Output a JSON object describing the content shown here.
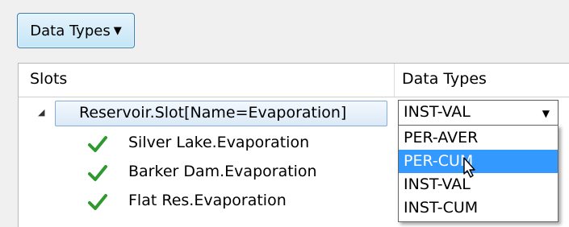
{
  "toolbar": {
    "data_types_button_label": "Data Types",
    "data_types_button_caret": "▼"
  },
  "grid": {
    "columns": [
      "Slots",
      "Data Types"
    ],
    "parent_row": {
      "expander": "◢",
      "label": "Reservoir.Slot[Name=Evaporation]",
      "data_type": "INST-VAL",
      "dropdown_arrow": "▼"
    },
    "children": [
      {
        "label": "Silver Lake.Evaporation",
        "icon": "check-icon"
      },
      {
        "label": "Barker Dam.Evaporation",
        "icon": "check-icon"
      },
      {
        "label": "Flat Res.Evaporation",
        "icon": "check-icon"
      }
    ]
  },
  "dropdown": {
    "options": [
      "PER-AVER",
      "PER-CUM",
      "INST-VAL",
      "INST-CUM"
    ],
    "highlighted": "PER-CUM"
  },
  "colors": {
    "highlight": "#3399ff",
    "check": "#2e9a2e",
    "parent_row_border": "#84acdd"
  }
}
